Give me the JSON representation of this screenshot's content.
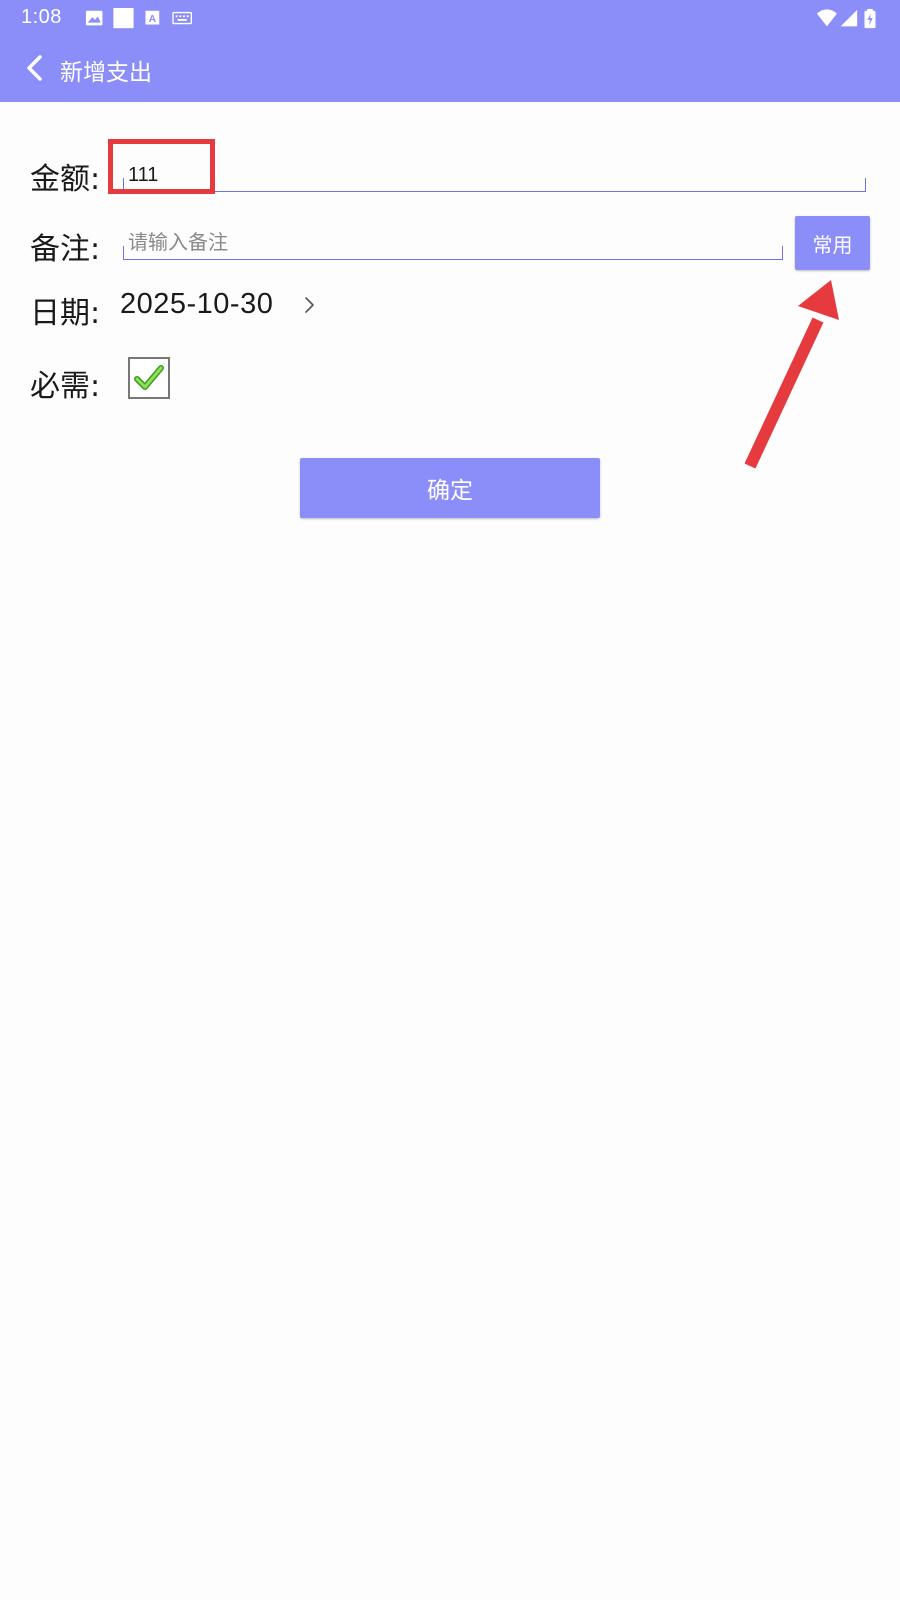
{
  "status_bar": {
    "time": "1:08",
    "left_icons": [
      "image-icon",
      "square-icon",
      "a-icon",
      "keyboard-icon"
    ],
    "right_icons": [
      "wifi-icon",
      "signal-icon",
      "battery-charging-icon"
    ]
  },
  "app_bar": {
    "title": "新增支出",
    "back_icon": "chevron-left-icon"
  },
  "form": {
    "amount_label": "金额:",
    "amount_value": "111",
    "note_label": "备注:",
    "note_placeholder": "请输入备注",
    "common_button_label": "常用",
    "date_label": "日期:",
    "date_value": "2025-10-30",
    "required_label": "必需:",
    "required_checked": true
  },
  "actions": {
    "confirm_label": "确定"
  },
  "colors": {
    "primary": "#8b8df8",
    "annotation_red": "#e53b3e",
    "check_green": "#5fc12f"
  }
}
